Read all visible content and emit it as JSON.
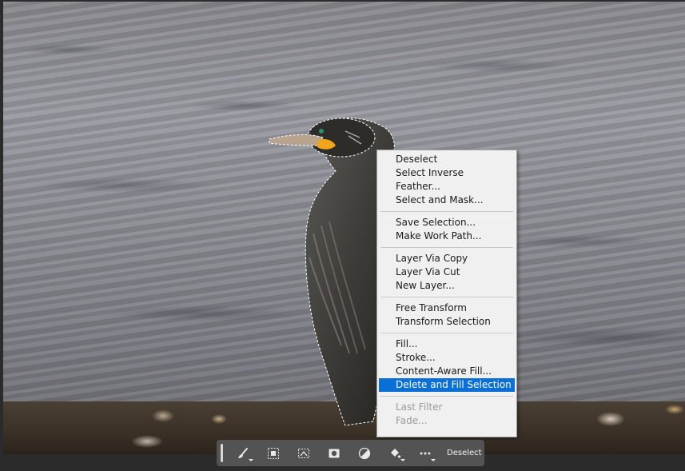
{
  "canvas": {
    "subject": ""
  },
  "context_menu": {
    "groups": [
      [
        {
          "label": "Deselect",
          "enabled": true
        },
        {
          "label": "Select Inverse",
          "enabled": true
        },
        {
          "label": "Feather...",
          "enabled": true
        },
        {
          "label": "Select and Mask...",
          "enabled": true
        }
      ],
      [
        {
          "label": "Save Selection...",
          "enabled": true
        },
        {
          "label": "Make Work Path...",
          "enabled": true
        }
      ],
      [
        {
          "label": "Layer Via Copy",
          "enabled": true
        },
        {
          "label": "Layer Via Cut",
          "enabled": true
        },
        {
          "label": "New Layer...",
          "enabled": true
        }
      ],
      [
        {
          "label": "Free Transform",
          "enabled": true
        },
        {
          "label": "Transform Selection",
          "enabled": true
        }
      ],
      [
        {
          "label": "Fill...",
          "enabled": true
        },
        {
          "label": "Stroke...",
          "enabled": true
        },
        {
          "label": "Content-Aware Fill...",
          "enabled": true
        },
        {
          "label": "Delete and Fill Selection",
          "enabled": true,
          "highlighted": true
        }
      ],
      [
        {
          "label": "Last Filter",
          "enabled": false
        },
        {
          "label": "Fade...",
          "enabled": false
        }
      ]
    ]
  },
  "taskbar": {
    "tools": [
      {
        "name": "brush-icon",
        "has_caret": true
      },
      {
        "name": "select-subject-icon",
        "has_caret": false
      },
      {
        "name": "transform-selection-icon",
        "has_caret": false
      },
      {
        "name": "mask-icon",
        "has_caret": false
      },
      {
        "name": "adjustment-icon",
        "has_caret": false
      },
      {
        "name": "fill-bucket-icon",
        "has_caret": true
      },
      {
        "name": "more-icon",
        "has_caret": true
      }
    ],
    "deselect_label": "Deselect"
  },
  "colors": {
    "menu_background": "#f0f0f0",
    "menu_highlight": "#0a6fd6",
    "taskbar_background": "#535353",
    "beak_accent": "#f2a51c"
  }
}
